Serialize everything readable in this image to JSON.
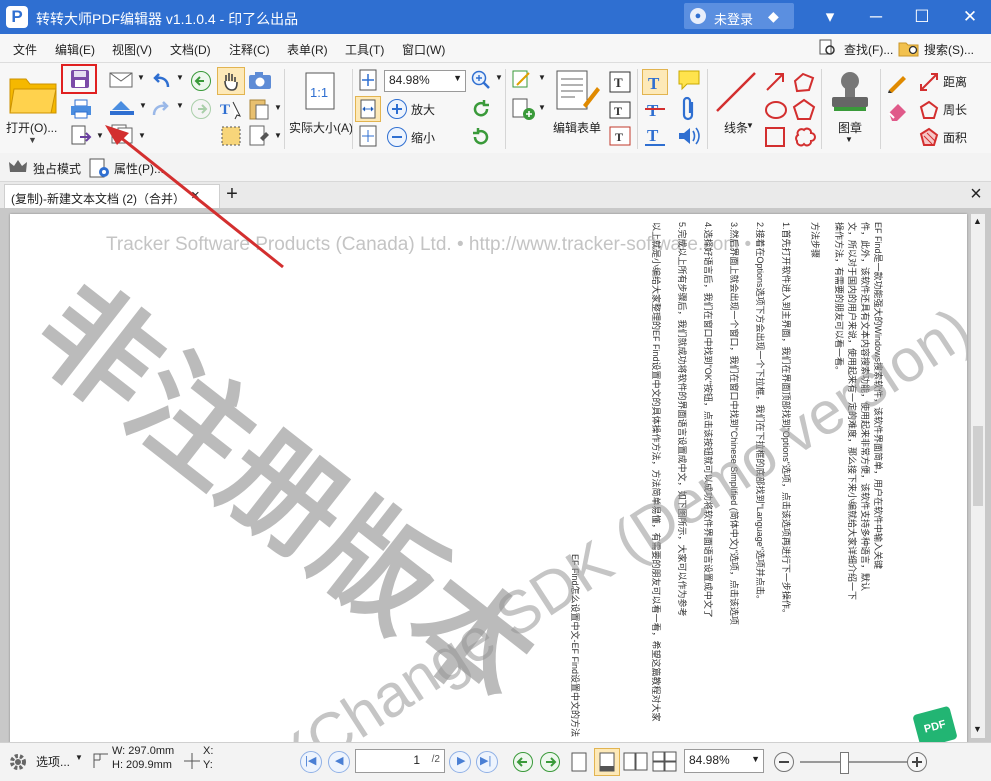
{
  "app": {
    "title": "转转大师PDF编辑器 v1.1.0.4 - 印了么出品",
    "logo_glyph": "P",
    "user_label": "未登录"
  },
  "colors": {
    "titlebar": "#2f6fd1",
    "accent_red": "#d32f2f",
    "highlight_box": "#e02020"
  },
  "menu": {
    "items": [
      "文件",
      "编辑(E)",
      "视图(V)",
      "文档(D)",
      "注释(C)",
      "表单(R)",
      "工具(T)",
      "窗口(W)"
    ],
    "find_label": "查找(F)...",
    "search_label": "搜索(S)..."
  },
  "ribbon": {
    "open_label": "打开(O)...",
    "actual_size_label": "实际大小(A)",
    "zoom_value": "84.98%",
    "zoom_in_label": "放大",
    "zoom_out_label": "缩小",
    "edit_form_label": "编辑表单",
    "line_label": "线条",
    "stamp_label": "图章",
    "distance_label": "距离",
    "perimeter_label": "周长",
    "area_label": "面积"
  },
  "toolbar2": {
    "exclusive_mode_label": "独占模式",
    "properties_label": "属性(P)..."
  },
  "tabs": {
    "doc_tab_label": "(复制)-新建文本文档 (2)（合并）",
    "close_glyph": "×",
    "add_glyph": "+"
  },
  "document": {
    "header_watermark": "Tracker Software Products (Canada) Ltd. • http://www.tracker-software.com •",
    "watermark_big": "非注册版本",
    "watermark_demo": "XChange SDK (Demo version)",
    "content_lines": [
      "EF Find是一款功能强大的Windows搜索软件，该软件界面简单，用户在软件中输入关键",
      "件，此外，该软件还具有文本内容搜索功能，使用起来非常方便，该软件支持多种语言，默认",
      "文，所以对于国内的用户来说，使用起来有一定的难度，那么接下来小编就给大家详细介绍一下",
      "操作方法，有需要的朋友可以看一看。",
      "方法步骤",
      "1.首先打开软件进入到主界面，我们在界面顶部找到\"Options\"选项，点击该选项再进行下一步操作。",
      "2.接着在Options选项下方会出现一个下拉框，我们在下拉框的底部找到\"Language\"选项并点击。",
      "3.然后界面上就会出现一个窗口，我们在窗口中找到\"Chinese Simplified (简体中文)\"选项，点击该选项",
      "4.选择好语言后，我们在窗口中找到\"OK\"按钮，点击该按钮就可以成功将软件界面语言设置成中文了",
      "5.完成以上所有步骤后，我们就成功将软件的界面语言设置成中文，如下图所示，大家可以作为参考",
      "以上就是小编给大家整理的EF Find设置中文的具体操作方法，方法简单易懂，有需要的朋友可以看一看，希望这篇教程对大家有所帮助。",
      "EF Find怎么设置中文-EF Find设置中文的方法"
    ]
  },
  "status": {
    "select_label": "选项...",
    "width_label": "W: 297.0mm",
    "height_label": "H: 209.9mm",
    "x_label": "X:",
    "y_label": "Y:",
    "page_current": "1",
    "page_total": "/2",
    "zoom_value": "84.98%"
  },
  "icons": {
    "save": "floppy-disk-icon",
    "print": "printer-icon",
    "open": "folder-icon"
  }
}
